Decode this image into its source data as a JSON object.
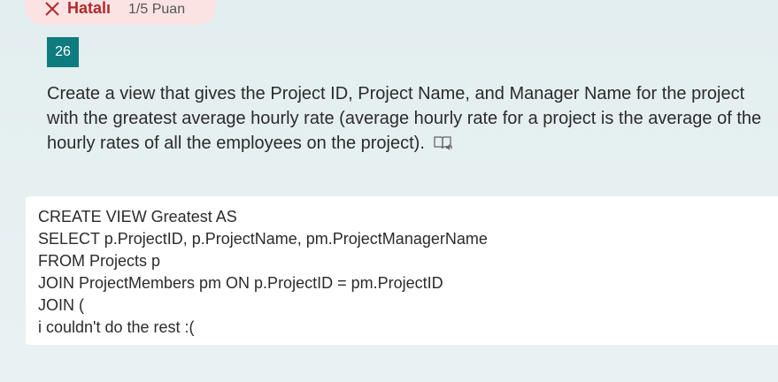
{
  "status": {
    "label": "Hatalı",
    "score": "1/5 Puan",
    "icon": "close-icon",
    "color": "#b02a2a",
    "background": "#fbe3e3"
  },
  "question": {
    "number": "26",
    "number_background": "#0e7b7f",
    "text": "Create a view that gives the Project ID, Project Name, and Manager Name for the project with the greatest average hourly rate (average hourly rate for a project is the average of the hourly rates of all the employees on the project).",
    "reader_icon": "immersive-reader-icon"
  },
  "answer": {
    "lines": [
      "CREATE VIEW Greatest AS",
      "SELECT p.ProjectID, p.ProjectName, pm.ProjectManagerName",
      "FROM Projects p",
      "JOIN ProjectMembers pm ON p.ProjectID = pm.ProjectID",
      "JOIN (",
      "i couldn't do the rest :("
    ]
  }
}
